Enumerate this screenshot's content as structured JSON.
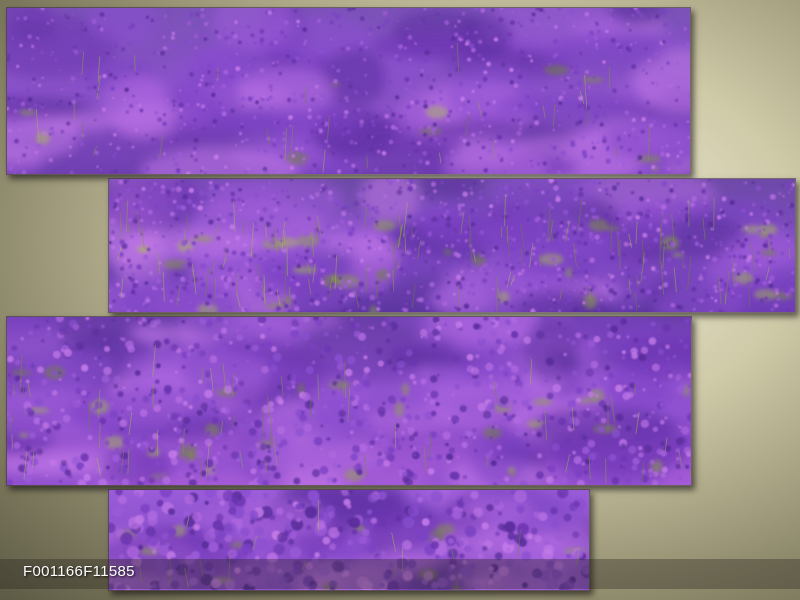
{
  "image": {
    "code": "F001166F11585",
    "subject_icon": "lavender-field-photo",
    "colors": {
      "background_light": "#f4f1de",
      "background_dark": "#5d5a45",
      "lavender_deep": "#5a2d9c",
      "lavender_mid": "#8a4fd0",
      "lavender_light": "#c37ae8",
      "foliage": "#8fae3a",
      "caption_text": "#ffffff"
    },
    "panel_count": 4
  }
}
